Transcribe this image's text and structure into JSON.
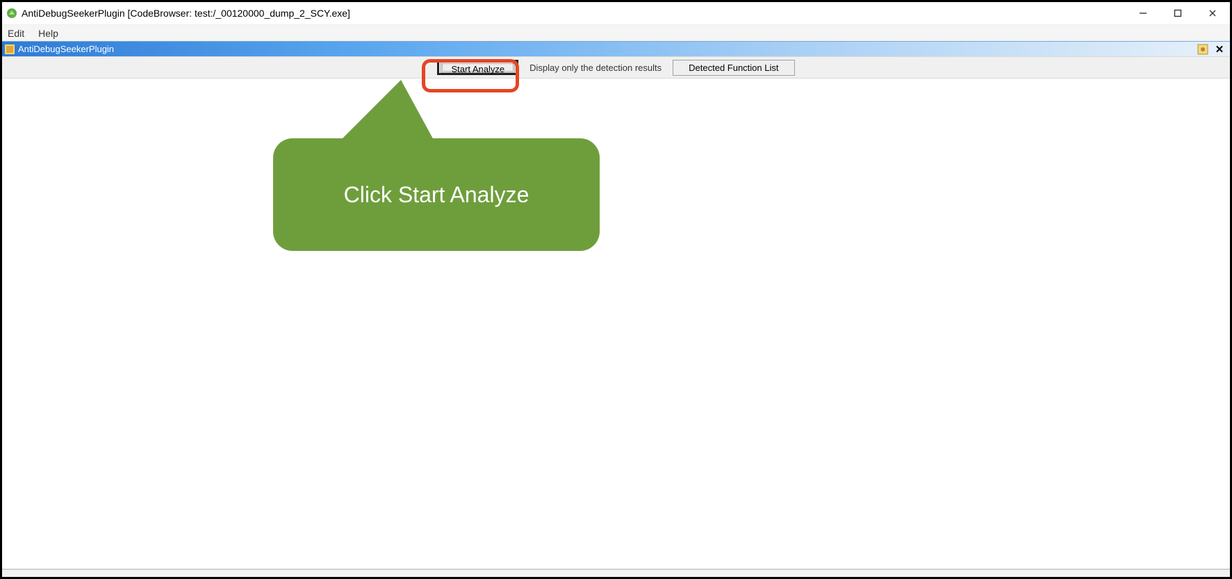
{
  "window": {
    "title": "AntiDebugSeekerPlugin [CodeBrowser: test:/_00120000_dump_2_SCY.exe]"
  },
  "menu": {
    "edit": "Edit",
    "help": "Help"
  },
  "plugin_header": {
    "title": "AntiDebugSeekerPlugin"
  },
  "toolbar": {
    "start_analyze": "Start Analyze",
    "display_only_label": "Display only the detection results",
    "detected_function_list": "Detected Function List"
  },
  "callout": {
    "text": "Click Start Analyze"
  }
}
